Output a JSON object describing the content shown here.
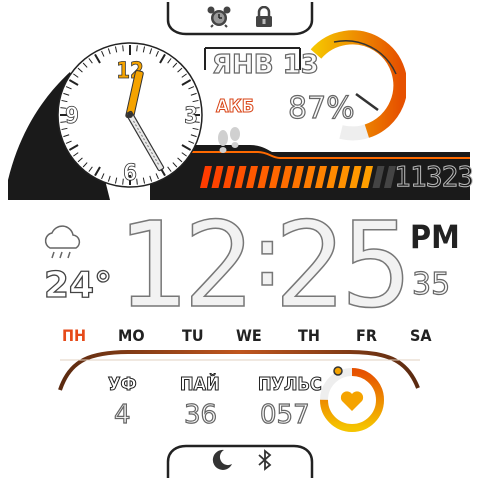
{
  "status_top": {
    "alarm_icon": "alarm-clock-icon",
    "lock_icon": "lock-icon"
  },
  "analog_clock": {
    "numerals": [
      "12",
      "3",
      "6",
      "9"
    ],
    "hour": 12,
    "minute": 25
  },
  "date": {
    "label": "ЯНВ 13"
  },
  "battery": {
    "label": "АКБ",
    "percent_text": "87%",
    "level": 0.87,
    "color": "#f5a300"
  },
  "steps": {
    "icon": "footsteps-icon",
    "value": "11323",
    "progress": 0.9,
    "color": "#e64a19"
  },
  "weather": {
    "icon": "cloud-rain-icon",
    "temp": "24°"
  },
  "digital_time": {
    "hours": "12",
    "minutes": "25",
    "ampm": "PM",
    "seconds": "35"
  },
  "weekdays": {
    "active": "ПН",
    "days": [
      "MO",
      "TU",
      "WE",
      "TH",
      "FR",
      "SA"
    ],
    "active_color": "#e64a19"
  },
  "complications": [
    {
      "label": "УФ",
      "value": "4"
    },
    {
      "label": "ПАЙ",
      "value": "36"
    },
    {
      "label": "ПУЛЬС",
      "value": "057"
    }
  ],
  "heart": {
    "icon": "heart-icon",
    "level": 0.75
  },
  "status_bottom": {
    "moon_icon": "moon-icon",
    "bluetooth_icon": "bluetooth-icon"
  },
  "colors": {
    "accent": "#f5a300",
    "accent_dark": "#e64a19",
    "dark": "#1a1a1a"
  }
}
